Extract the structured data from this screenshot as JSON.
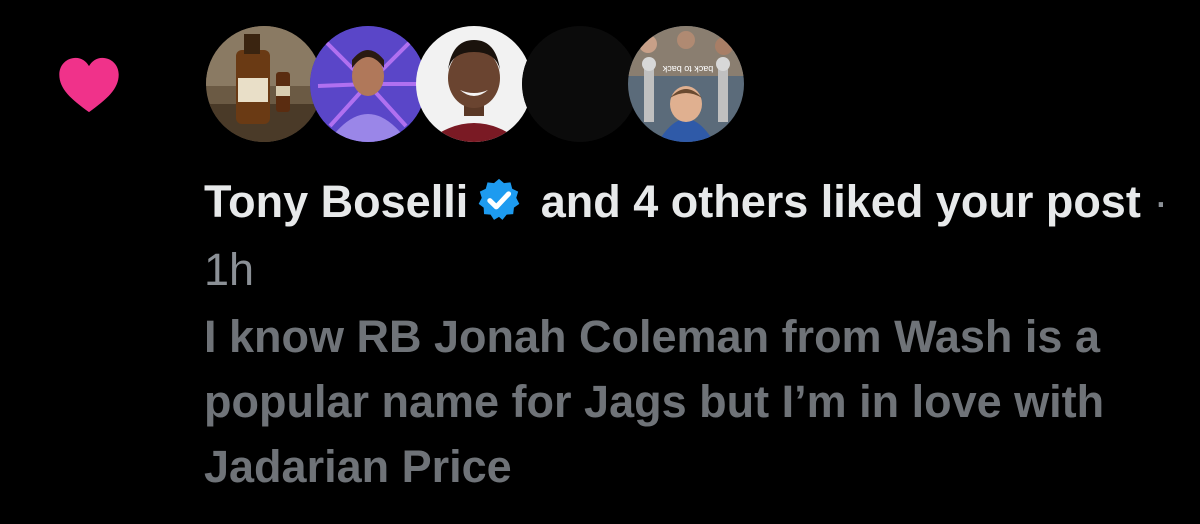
{
  "notification": {
    "icon": "heart-icon",
    "accent_color": "#f0328a",
    "verified_color": "#1d9bf0",
    "avatars": [
      {
        "name": "avatar-1"
      },
      {
        "name": "avatar-2"
      },
      {
        "name": "avatar-3"
      },
      {
        "name": "avatar-4"
      },
      {
        "name": "avatar-5",
        "caption": "back to back"
      }
    ],
    "actor_name": "Tony Boselli",
    "action_text": " and 4 others liked your post",
    "separator": " · ",
    "timestamp": "1h",
    "post_text": "I know RB Jonah Coleman from Wash is a popular name for Jags but I’m in love with Jadarian Price"
  }
}
